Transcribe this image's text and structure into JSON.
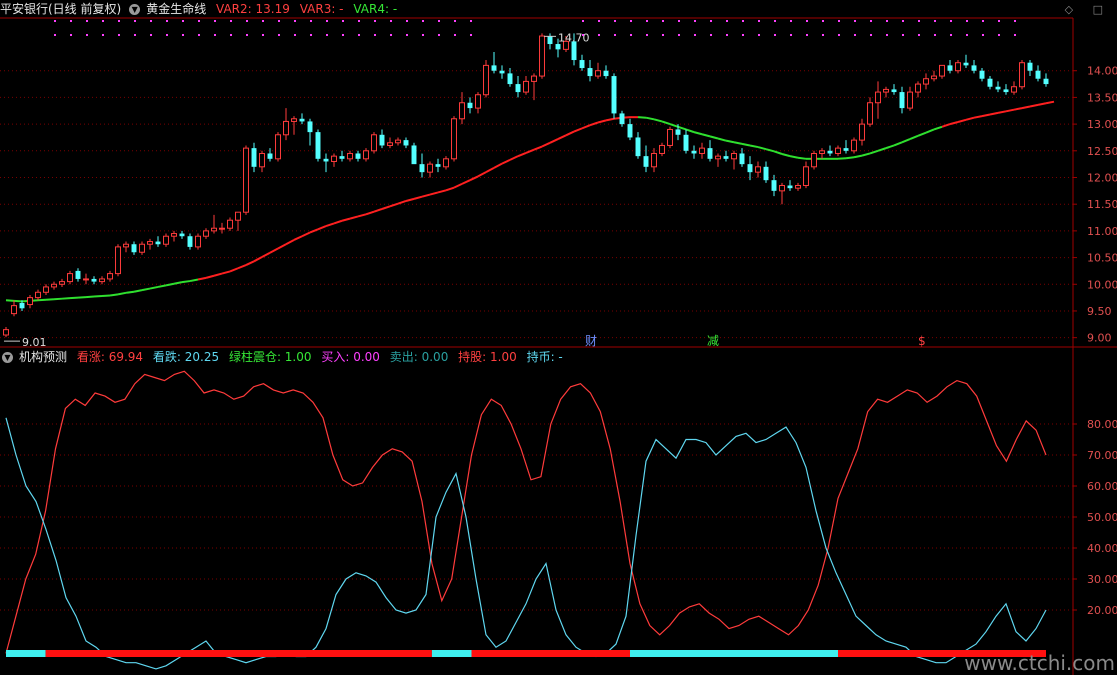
{
  "header_top": {
    "stock": "平安银行(日线 前复权)",
    "indicator": "黄金生命线",
    "var2": "VAR2: 13.19",
    "var3": "VAR3: -",
    "var4": "VAR4: -"
  },
  "header_bottom": {
    "indicator": "机构预测",
    "kanzhang": "看涨: 69.94",
    "kandie": "看跌: 20.25",
    "lvzhu": "绿柱震仓: 1.00",
    "mairu": "买入: 0.00",
    "maichu": "卖出: 0.00",
    "chigu": "持股: 1.00",
    "chibi": "持币: -"
  },
  "markers": {
    "cai": "财",
    "jian": "减",
    "dollar": "$"
  },
  "annotations": {
    "high": "14.70",
    "low": "9.01"
  },
  "watermark": "www.ctchi.com",
  "colors": {
    "up": "#ff3b3b",
    "down": "#54ffff",
    "lifeline_red": "#ff2020",
    "lifeline_green": "#2fe02f",
    "grid": "#7a0000"
  },
  "chart_data": [
    {
      "type": "candlestick",
      "title": "黄金生命线",
      "yaxis_ticks": [
        "14.00",
        "13.50",
        "13.00",
        "12.50",
        "12.00",
        "11.50",
        "11.00",
        "10.50",
        "10.00",
        "9.50",
        "9.00"
      ],
      "ylim": [
        8.9,
        14.95
      ],
      "ohlc": [
        [
          9.05,
          9.2,
          9.01,
          9.15
        ],
        [
          9.45,
          9.7,
          9.4,
          9.6
        ],
        [
          9.65,
          9.7,
          9.5,
          9.55
        ],
        [
          9.62,
          9.8,
          9.55,
          9.75
        ],
        [
          9.75,
          9.9,
          9.7,
          9.85
        ],
        [
          9.85,
          10.0,
          9.8,
          9.95
        ],
        [
          9.95,
          10.05,
          9.9,
          10.0
        ],
        [
          10.0,
          10.1,
          9.95,
          10.05
        ],
        [
          10.05,
          10.25,
          10.0,
          10.2
        ],
        [
          10.25,
          10.3,
          10.05,
          10.1
        ],
        [
          10.1,
          10.2,
          10.0,
          10.1
        ],
        [
          10.1,
          10.15,
          10.0,
          10.05
        ],
        [
          10.05,
          10.15,
          10.0,
          10.1
        ],
        [
          10.1,
          10.25,
          10.05,
          10.2
        ],
        [
          10.2,
          10.75,
          10.15,
          10.7
        ],
        [
          10.7,
          10.8,
          10.6,
          10.75
        ],
        [
          10.75,
          10.8,
          10.55,
          10.6
        ],
        [
          10.6,
          10.8,
          10.55,
          10.75
        ],
        [
          10.75,
          10.85,
          10.65,
          10.8
        ],
        [
          10.8,
          10.9,
          10.7,
          10.75
        ],
        [
          10.75,
          10.95,
          10.7,
          10.9
        ],
        [
          10.9,
          11.0,
          10.8,
          10.95
        ],
        [
          10.95,
          11.0,
          10.85,
          10.9
        ],
        [
          10.9,
          10.95,
          10.65,
          10.7
        ],
        [
          10.7,
          10.95,
          10.65,
          10.9
        ],
        [
          10.9,
          11.05,
          10.85,
          11.0
        ],
        [
          11.0,
          11.3,
          10.95,
          11.05
        ],
        [
          11.05,
          11.15,
          10.95,
          11.05
        ],
        [
          11.05,
          11.25,
          11.0,
          11.2
        ],
        [
          11.2,
          11.3,
          11.0,
          11.35
        ],
        [
          11.35,
          12.6,
          11.3,
          12.55
        ],
        [
          12.55,
          12.65,
          12.1,
          12.2
        ],
        [
          12.2,
          12.5,
          12.1,
          12.45
        ],
        [
          12.45,
          12.55,
          12.3,
          12.35
        ],
        [
          12.35,
          12.85,
          12.3,
          12.8
        ],
        [
          12.8,
          13.3,
          12.7,
          13.05
        ],
        [
          13.05,
          13.15,
          12.8,
          13.1
        ],
        [
          13.1,
          13.2,
          13.0,
          13.05
        ],
        [
          13.05,
          13.1,
          12.6,
          12.85
        ],
        [
          12.85,
          12.9,
          12.3,
          12.35
        ],
        [
          12.35,
          12.45,
          12.1,
          12.3
        ],
        [
          12.3,
          12.45,
          12.2,
          12.4
        ],
        [
          12.4,
          12.5,
          12.3,
          12.35
        ],
        [
          12.35,
          12.5,
          12.3,
          12.45
        ],
        [
          12.45,
          12.5,
          12.3,
          12.35
        ],
        [
          12.35,
          12.55,
          12.3,
          12.5
        ],
        [
          12.5,
          12.85,
          12.45,
          12.8
        ],
        [
          12.8,
          12.9,
          12.55,
          12.6
        ],
        [
          12.6,
          12.75,
          12.55,
          12.65
        ],
        [
          12.65,
          12.75,
          12.6,
          12.7
        ],
        [
          12.7,
          12.75,
          12.55,
          12.6
        ],
        [
          12.6,
          12.65,
          12.4,
          12.25
        ],
        [
          12.25,
          12.45,
          12.0,
          12.1
        ],
        [
          12.1,
          12.3,
          12.0,
          12.25
        ],
        [
          12.25,
          12.35,
          12.1,
          12.2
        ],
        [
          12.2,
          12.4,
          12.15,
          12.35
        ],
        [
          12.35,
          13.15,
          12.3,
          13.1
        ],
        [
          13.1,
          13.6,
          13.0,
          13.4
        ],
        [
          13.4,
          13.5,
          13.2,
          13.3
        ],
        [
          13.3,
          13.6,
          13.2,
          13.55
        ],
        [
          13.55,
          14.2,
          13.5,
          14.1
        ],
        [
          14.1,
          14.35,
          13.95,
          14.0
        ],
        [
          14.0,
          14.1,
          13.85,
          13.95
        ],
        [
          13.95,
          14.05,
          13.7,
          13.75
        ],
        [
          13.75,
          13.9,
          13.5,
          13.6
        ],
        [
          13.6,
          13.9,
          13.55,
          13.8
        ],
        [
          13.8,
          13.95,
          13.45,
          13.9
        ],
        [
          13.9,
          14.7,
          13.85,
          14.65
        ],
        [
          14.65,
          14.7,
          14.4,
          14.5
        ],
        [
          14.5,
          14.6,
          14.25,
          14.4
        ],
        [
          14.4,
          14.65,
          14.35,
          14.55
        ],
        [
          14.55,
          14.7,
          14.1,
          14.2
        ],
        [
          14.2,
          14.3,
          14.0,
          14.05
        ],
        [
          14.05,
          14.2,
          13.8,
          13.9
        ],
        [
          13.9,
          14.15,
          13.85,
          14.0
        ],
        [
          14.0,
          14.1,
          13.85,
          13.9
        ],
        [
          13.9,
          13.95,
          13.1,
          13.2
        ],
        [
          13.2,
          13.25,
          12.95,
          13.0
        ],
        [
          13.0,
          13.1,
          12.7,
          12.75
        ],
        [
          12.75,
          12.85,
          12.35,
          12.4
        ],
        [
          12.4,
          12.6,
          12.1,
          12.2
        ],
        [
          12.2,
          12.55,
          12.1,
          12.45
        ],
        [
          12.45,
          12.65,
          12.4,
          12.6
        ],
        [
          12.6,
          12.95,
          12.55,
          12.9
        ],
        [
          12.9,
          13.0,
          12.7,
          12.8
        ],
        [
          12.8,
          12.9,
          12.45,
          12.5
        ],
        [
          12.5,
          12.6,
          12.35,
          12.45
        ],
        [
          12.45,
          12.65,
          12.35,
          12.55
        ],
        [
          12.55,
          12.7,
          12.3,
          12.35
        ],
        [
          12.35,
          12.45,
          12.2,
          12.4
        ],
        [
          12.4,
          12.5,
          12.3,
          12.35
        ],
        [
          12.35,
          12.5,
          12.15,
          12.45
        ],
        [
          12.45,
          12.55,
          12.2,
          12.25
        ],
        [
          12.25,
          12.4,
          11.95,
          12.1
        ],
        [
          12.1,
          12.3,
          12.0,
          12.2
        ],
        [
          12.2,
          12.3,
          11.9,
          11.95
        ],
        [
          11.95,
          12.05,
          11.65,
          11.75
        ],
        [
          11.75,
          11.9,
          11.5,
          11.85
        ],
        [
          11.85,
          11.95,
          11.75,
          11.8
        ],
        [
          11.8,
          11.9,
          11.75,
          11.85
        ],
        [
          11.85,
          12.3,
          11.8,
          12.2
        ],
        [
          12.2,
          12.5,
          12.15,
          12.45
        ],
        [
          12.45,
          12.55,
          12.35,
          12.5
        ],
        [
          12.5,
          12.6,
          12.4,
          12.45
        ],
        [
          12.45,
          12.6,
          12.4,
          12.55
        ],
        [
          12.55,
          12.7,
          12.45,
          12.5
        ],
        [
          12.5,
          12.75,
          12.45,
          12.7
        ],
        [
          12.7,
          13.1,
          12.6,
          13.0
        ],
        [
          13.0,
          13.5,
          12.95,
          13.4
        ],
        [
          13.4,
          13.8,
          13.1,
          13.6
        ],
        [
          13.6,
          13.7,
          13.5,
          13.65
        ],
        [
          13.65,
          13.75,
          13.55,
          13.6
        ],
        [
          13.6,
          13.7,
          13.2,
          13.3
        ],
        [
          13.3,
          13.7,
          13.25,
          13.6
        ],
        [
          13.6,
          13.8,
          13.5,
          13.75
        ],
        [
          13.75,
          13.95,
          13.65,
          13.85
        ],
        [
          13.85,
          14.0,
          13.8,
          13.9
        ],
        [
          13.9,
          14.05,
          13.85,
          14.1
        ],
        [
          14.1,
          14.2,
          13.95,
          14.0
        ],
        [
          14.0,
          14.2,
          13.95,
          14.15
        ],
        [
          14.15,
          14.3,
          14.05,
          14.1
        ],
        [
          14.1,
          14.2,
          13.95,
          14.0
        ],
        [
          14.0,
          14.05,
          13.8,
          13.85
        ],
        [
          13.85,
          13.9,
          13.65,
          13.7
        ],
        [
          13.7,
          13.8,
          13.6,
          13.65
        ],
        [
          13.65,
          13.75,
          13.55,
          13.6
        ],
        [
          13.6,
          13.8,
          13.55,
          13.7
        ],
        [
          13.7,
          14.2,
          13.65,
          14.15
        ],
        [
          14.15,
          14.2,
          13.9,
          14.0
        ],
        [
          14.0,
          14.1,
          13.8,
          13.85
        ],
        [
          13.85,
          13.95,
          13.7,
          13.75
        ]
      ],
      "lifeline": [
        9.7,
        9.69,
        9.68,
        9.69,
        9.7,
        9.71,
        9.72,
        9.73,
        9.74,
        9.75,
        9.76,
        9.77,
        9.78,
        9.79,
        9.81,
        9.84,
        9.86,
        9.89,
        9.92,
        9.95,
        9.98,
        10.01,
        10.04,
        10.06,
        10.09,
        10.12,
        10.16,
        10.2,
        10.24,
        10.3,
        10.36,
        10.43,
        10.51,
        10.59,
        10.67,
        10.75,
        10.83,
        10.9,
        10.97,
        11.03,
        11.09,
        11.14,
        11.19,
        11.23,
        11.27,
        11.31,
        11.36,
        11.41,
        11.46,
        11.51,
        11.56,
        11.6,
        11.64,
        11.68,
        11.72,
        11.76,
        11.81,
        11.88,
        11.95,
        12.02,
        12.1,
        12.18,
        12.26,
        12.33,
        12.4,
        12.46,
        12.52,
        12.58,
        12.65,
        12.72,
        12.79,
        12.86,
        12.92,
        12.98,
        13.03,
        13.07,
        13.1,
        13.12,
        13.13,
        13.13,
        13.12,
        13.09,
        13.05,
        13.0,
        12.95,
        12.9,
        12.85,
        12.81,
        12.77,
        12.73,
        12.69,
        12.66,
        12.63,
        12.6,
        12.57,
        12.53,
        12.49,
        12.44,
        12.4,
        12.37,
        12.35,
        12.35,
        12.35,
        12.35,
        12.35,
        12.36,
        12.38,
        12.41,
        12.45,
        12.5,
        12.55,
        12.6,
        12.66,
        12.72,
        12.78,
        12.84,
        12.9,
        12.95,
        13.0,
        13.04,
        13.08,
        13.12,
        13.15,
        13.18,
        13.21,
        13.24,
        13.27,
        13.3,
        13.33,
        13.36,
        13.39,
        13.42
      ],
      "lifeline_green_ranges": [
        [
          0,
          24
        ],
        [
          79,
          117
        ]
      ],
      "high_label": "14.70",
      "low_label": "9.01"
    },
    {
      "type": "line",
      "title": "机构预测",
      "yaxis_ticks": [
        "80.00",
        "70.00",
        "60.00",
        "50.00",
        "40.00",
        "30.00",
        "20.00"
      ],
      "ylim": [
        0,
        100
      ],
      "series": [
        {
          "name": "看涨",
          "color": "#ff3b3b",
          "values": [
            6,
            18,
            30,
            38,
            52,
            72,
            85,
            88,
            86,
            90,
            89,
            87,
            88,
            93,
            96,
            95,
            94,
            96,
            97,
            94,
            90,
            91,
            90,
            88,
            89,
            92,
            93,
            91,
            90,
            91,
            90,
            87,
            82,
            70,
            62,
            60,
            61,
            66,
            70,
            72,
            71,
            68,
            55,
            35,
            23,
            30,
            50,
            70,
            83,
            88,
            86,
            80,
            72,
            62,
            63,
            80,
            88,
            92,
            93,
            90,
            84,
            72,
            55,
            35,
            22,
            15,
            12,
            15,
            19,
            21,
            22,
            19,
            17,
            14,
            15,
            17,
            18,
            16,
            14,
            12,
            15,
            20,
            28,
            40,
            56,
            64,
            72,
            84,
            88,
            87,
            89,
            91,
            90,
            87,
            89,
            92,
            94,
            93,
            89,
            81,
            73,
            68,
            75,
            81,
            78,
            70
          ]
        },
        {
          "name": "看跌",
          "color": "#5fd7f0",
          "values": [
            82,
            70,
            60,
            55,
            46,
            36,
            24,
            18,
            10,
            8,
            5,
            4,
            3,
            3,
            2,
            1,
            2,
            4,
            6,
            8,
            10,
            6,
            5,
            4,
            3,
            4,
            5,
            5,
            6,
            5,
            5,
            8,
            14,
            25,
            30,
            32,
            31,
            29,
            24,
            20,
            19,
            20,
            25,
            50,
            58,
            64,
            50,
            30,
            12,
            8,
            10,
            16,
            22,
            30,
            35,
            20,
            12,
            8,
            6,
            5,
            6,
            9,
            18,
            44,
            68,
            75,
            72,
            69,
            75,
            75,
            74,
            70,
            73,
            76,
            77,
            74,
            75,
            77,
            79,
            74,
            66,
            52,
            40,
            32,
            25,
            18,
            15,
            12,
            10,
            9,
            8,
            5,
            4,
            3,
            3,
            5,
            7,
            9,
            13,
            18,
            22,
            13,
            10,
            14,
            20
          ]
        }
      ],
      "bottom_bar_colors": [
        "cyan",
        "red",
        "cyan",
        "red",
        "cyan",
        "red"
      ],
      "bottom_bar_segments": [
        [
          0,
          4
        ],
        [
          4,
          43
        ],
        [
          43,
          47
        ],
        [
          47,
          63
        ],
        [
          63,
          84
        ],
        [
          84,
          105
        ]
      ]
    }
  ]
}
